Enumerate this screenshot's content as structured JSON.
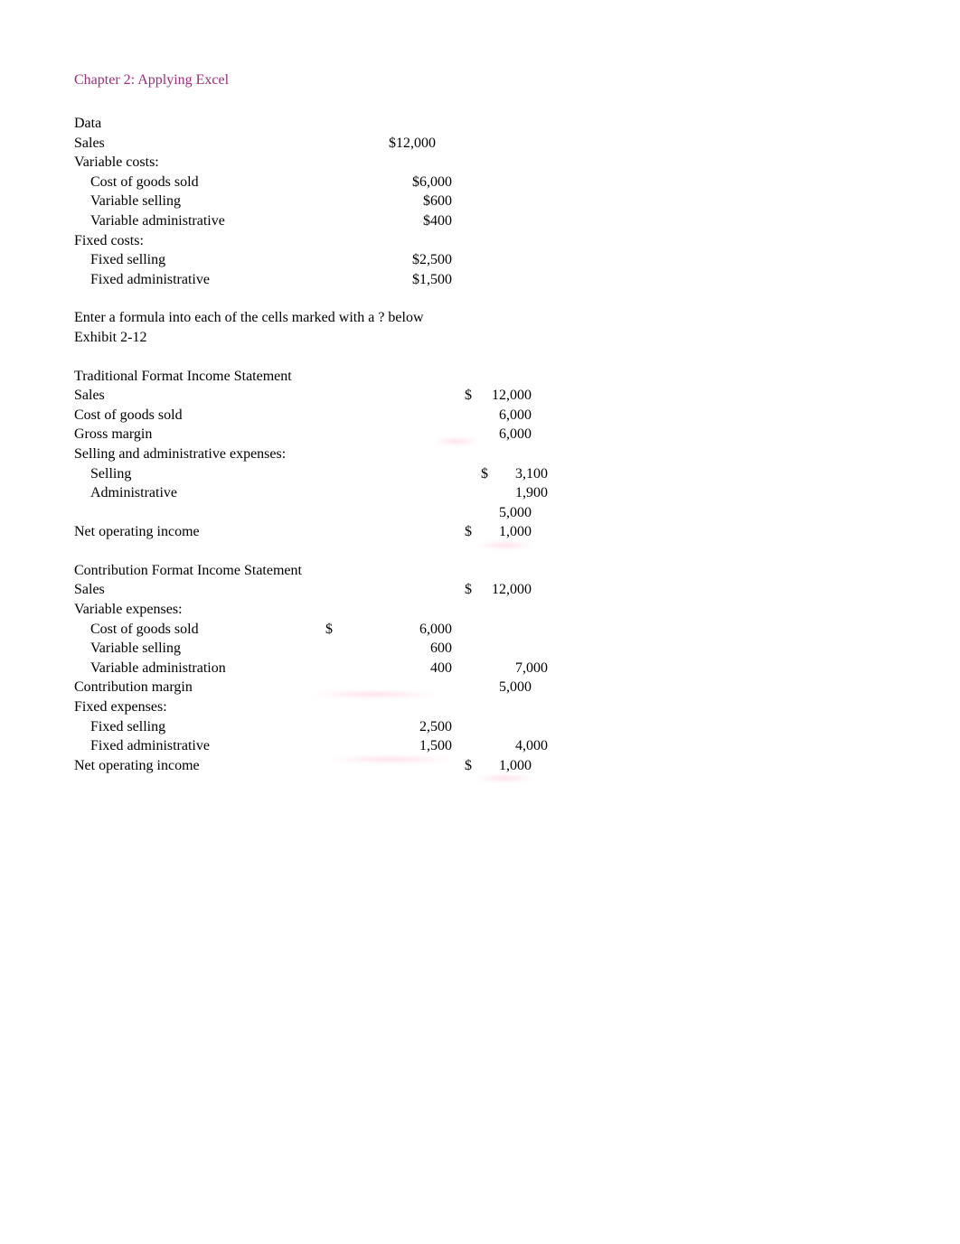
{
  "title": "Chapter 2: Applying Excel",
  "data_section": {
    "heading": "Data",
    "sales_label": "Sales",
    "sales_value": "$12,000",
    "variable_costs_label": "Variable costs:",
    "cogs_label": "Cost of goods sold",
    "cogs_value": "$6,000",
    "var_selling_label": "Variable selling",
    "var_selling_value": "$600",
    "var_admin_label": "Variable administrative",
    "var_admin_value": "$400",
    "fixed_costs_label": "Fixed costs:",
    "fixed_selling_label": "Fixed selling",
    "fixed_selling_value": "$2,500",
    "fixed_admin_label": "Fixed administrative",
    "fixed_admin_value": "$1,500"
  },
  "instructions": {
    "line1": "Enter a formula into each of the cells marked with a ? below",
    "line2": "Exhibit 2-12"
  },
  "traditional": {
    "heading": "Traditional Format Income Statement",
    "sales_label": "Sales",
    "sales_cur": "$",
    "sales_val": "12,000",
    "cogs_label": "Cost of goods sold",
    "cogs_val": "6,000",
    "gross_margin_label": "Gross margin",
    "gross_margin_val": "6,000",
    "sae_label": "Selling and administrative expenses:",
    "selling_label": "Selling",
    "selling_cur": "$",
    "selling_val": "3,100",
    "admin_label": "Administrative",
    "admin_val": "1,900",
    "sae_total_val": "5,000",
    "noi_label": "Net operating income",
    "noi_cur": "$",
    "noi_val": "1,000"
  },
  "contribution": {
    "heading": "Contribution Format Income Statement",
    "sales_label": "Sales",
    "sales_cur": "$",
    "sales_val": "12,000",
    "var_exp_label": "Variable expenses:",
    "cogs_label": "Cost of goods sold",
    "cogs_cur": "$",
    "cogs_val": "6,000",
    "var_selling_label": "Variable selling",
    "var_selling_val": "600",
    "var_admin_label": "Variable administration",
    "var_admin_val": "400",
    "var_total_val": "7,000",
    "cm_label": "Contribution margin",
    "cm_val": "5,000",
    "fixed_exp_label": "Fixed expenses:",
    "fixed_selling_label": "Fixed selling",
    "fixed_selling_val": "2,500",
    "fixed_admin_label": "Fixed administrative",
    "fixed_admin_val": "1,500",
    "fixed_total_val": "4,000",
    "noi_label": "Net operating income",
    "noi_cur": "$",
    "noi_val": "1,000"
  },
  "chart_data": {
    "type": "table",
    "title": "Chapter 2: Applying Excel",
    "data_inputs": {
      "Sales": 12000,
      "Variable costs": {
        "Cost of goods sold": 6000,
        "Variable selling": 600,
        "Variable administrative": 400
      },
      "Fixed costs": {
        "Fixed selling": 2500,
        "Fixed administrative": 1500
      }
    },
    "traditional_format_income_statement": {
      "Sales": 12000,
      "Cost of goods sold": 6000,
      "Gross margin": 6000,
      "Selling and administrative expenses": {
        "Selling": 3100,
        "Administrative": 1900,
        "Total": 5000
      },
      "Net operating income": 1000
    },
    "contribution_format_income_statement": {
      "Sales": 12000,
      "Variable expenses": {
        "Cost of goods sold": 6000,
        "Variable selling": 600,
        "Variable administration": 400,
        "Total": 7000
      },
      "Contribution margin": 5000,
      "Fixed expenses": {
        "Fixed selling": 2500,
        "Fixed administrative": 1500,
        "Total": 4000
      },
      "Net operating income": 1000
    }
  }
}
